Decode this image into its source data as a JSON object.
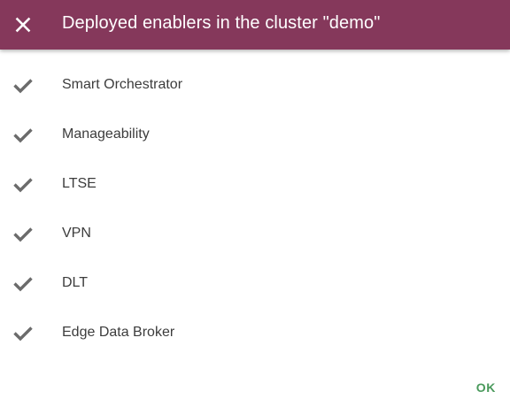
{
  "dialog": {
    "title": "Deployed enablers in the cluster \"demo\"",
    "close_icon": "close-icon",
    "ok_label": "OK"
  },
  "colors": {
    "header_bg": "#85385b",
    "check": "#6b6b6b",
    "ok": "#4a9a5c"
  },
  "enablers": [
    {
      "label": "Smart Orchestrator",
      "icon": "check-icon"
    },
    {
      "label": "Manageability",
      "icon": "check-icon"
    },
    {
      "label": "LTSE",
      "icon": "check-icon"
    },
    {
      "label": "VPN",
      "icon": "check-icon"
    },
    {
      "label": "DLT",
      "icon": "check-icon"
    },
    {
      "label": "Edge Data Broker",
      "icon": "check-icon"
    }
  ]
}
